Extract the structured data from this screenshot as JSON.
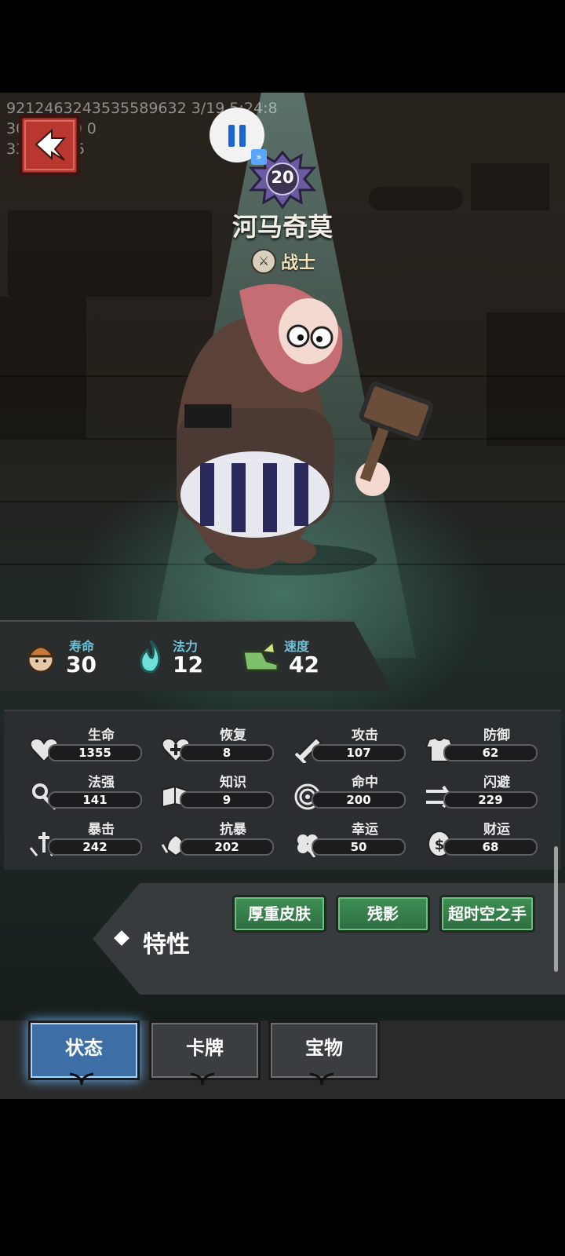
{
  "debug": {
    "line1": "92124632435355896323/195:24:8",
    "line1_display": "9212463243535589632 3/19 5:24:8",
    "line2": "30005 0 0 0",
    "line3": "33837 5_5"
  },
  "character": {
    "level": "20",
    "name": "河马奇莫",
    "class": "战士"
  },
  "top_stats": [
    {
      "label": "寿命",
      "value": "30",
      "icon": "lifespan-icon"
    },
    {
      "label": "法力",
      "value": "12",
      "icon": "mana-flame-icon"
    },
    {
      "label": "速度",
      "value": "42",
      "icon": "speed-boot-icon"
    }
  ],
  "attributes": [
    {
      "label": "生命",
      "value": "1355",
      "icon": "heart-icon"
    },
    {
      "label": "恢复",
      "value": "8",
      "icon": "heal-heart-icon"
    },
    {
      "label": "攻击",
      "value": "107",
      "icon": "sword-icon"
    },
    {
      "label": "防御",
      "value": "62",
      "icon": "armor-icon"
    },
    {
      "label": "法强",
      "value": "141",
      "icon": "staff-icon"
    },
    {
      "label": "知识",
      "value": "9",
      "icon": "book-icon"
    },
    {
      "label": "命中",
      "value": "200",
      "icon": "target-icon"
    },
    {
      "label": "闪避",
      "value": "229",
      "icon": "dodge-arrows-icon"
    },
    {
      "label": "暴击",
      "value": "242",
      "icon": "crit-dagger-icon"
    },
    {
      "label": "抗暴",
      "value": "202",
      "icon": "crit-resist-icon"
    },
    {
      "label": "幸运",
      "value": "50",
      "icon": "clover-icon"
    },
    {
      "label": "财运",
      "value": "68",
      "icon": "coin-icon"
    }
  ],
  "traits": {
    "title": "特性",
    "items": [
      "厚重皮肤",
      "残影",
      "超时空之手"
    ]
  },
  "tabs": [
    {
      "label": "状态",
      "active": true
    },
    {
      "label": "卡牌",
      "active": false
    },
    {
      "label": "宝物",
      "active": false
    }
  ],
  "colors": {
    "accent_green": "#3f8f55",
    "tab_active": "#3d6fa6",
    "stat_label": "#6fc1d6",
    "back_button": "#b8372f",
    "pause_icon": "#1b64d6"
  }
}
